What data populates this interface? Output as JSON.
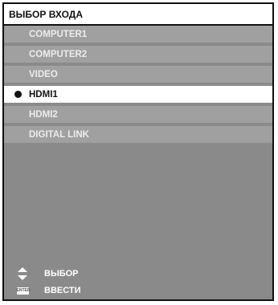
{
  "menu": {
    "title": "ВЫБОР ВХОДА",
    "items": [
      {
        "label": "COMPUTER1",
        "selected": false
      },
      {
        "label": "COMPUTER2",
        "selected": false
      },
      {
        "label": "VIDEO",
        "selected": false
      },
      {
        "label": "HDMI1",
        "selected": true
      },
      {
        "label": "HDMI2",
        "selected": false
      },
      {
        "label": "DIGITAL LINK",
        "selected": false
      }
    ]
  },
  "footer": {
    "select_label": "ВЫБОР",
    "enter_label": "ВВЕСТИ",
    "enter_badge": "ENTER",
    "select_icon": "up-down-arrows-icon",
    "enter_icon": "enter-key-icon"
  },
  "colors": {
    "panel_background": "#8a8a8a",
    "item_background": "#a0a0a0",
    "item_text": "#ececec",
    "selected_background": "#ffffff",
    "selected_text": "#111111",
    "border": "#111111"
  }
}
